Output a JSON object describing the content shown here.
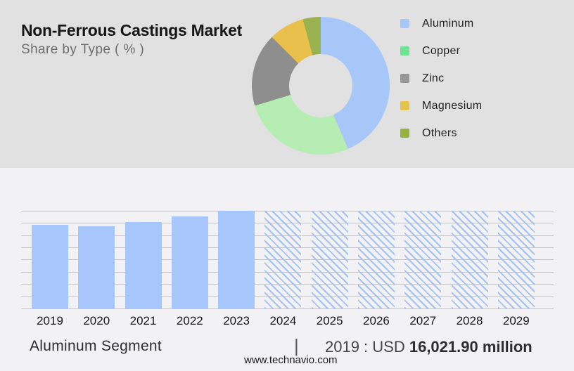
{
  "header": {
    "title": "Non-Ferrous Castings Market",
    "subtitle": "Share by Type ( % )"
  },
  "legend": {
    "items": [
      {
        "label": "Aluminum",
        "color": "#a7c6fa"
      },
      {
        "label": "Copper",
        "color": "#6fe392"
      },
      {
        "label": "Zinc",
        "color": "#979797"
      },
      {
        "label": "Magnesium",
        "color": "#e3c44e"
      },
      {
        "label": "Others",
        "color": "#98b23e"
      }
    ]
  },
  "footer": {
    "caption": "Aluminum Segment",
    "divider": "|",
    "value_prefix": "2019 : USD ",
    "value_bold": "16,021.90 million",
    "website": "www.technavio.com"
  },
  "chart_data": [
    {
      "type": "pie",
      "donut": true,
      "title": "Non-Ferrous Castings Market",
      "subtitle": "Share by Type ( % )",
      "labels": [
        "Aluminum",
        "Copper",
        "Zinc",
        "Magnesium",
        "Others"
      ],
      "values_percent_est": [
        43.5,
        26.8,
        17.2,
        8.3,
        4.2
      ],
      "slice_colors": [
        "#a7c7f9",
        "#b5edb2",
        "#8e8e8e",
        "#e9c04c",
        "#9ab350"
      ],
      "start_angle_deg": 0,
      "direction": "clockwise",
      "legend_position": "right"
    },
    {
      "type": "bar",
      "categories": [
        "2019",
        "2020",
        "2021",
        "2022",
        "2023",
        "2024",
        "2025",
        "2026",
        "2027",
        "2028",
        "2029"
      ],
      "series": [
        {
          "name": "Aluminum Segment",
          "values_usd_million_est": [
            16021.9,
            15670,
            16600,
            17590,
            18720,
            null,
            null,
            null,
            null,
            null,
            null
          ],
          "relative_heights": [
            0.856,
            0.838,
            0.887,
            0.94,
            1,
            1,
            1,
            1,
            1,
            1,
            1
          ],
          "forecast": [
            false,
            false,
            false,
            false,
            false,
            true,
            true,
            true,
            true,
            true,
            true
          ]
        }
      ],
      "bar_color": "#a7c6fb",
      "forecast_hatch_color": "#a3c1f2",
      "gridline_count": 9,
      "y_axis": "unlabeled",
      "labeled_point": {
        "year": "2019",
        "text": "2019 : USD 16,021.90 million"
      }
    }
  ]
}
